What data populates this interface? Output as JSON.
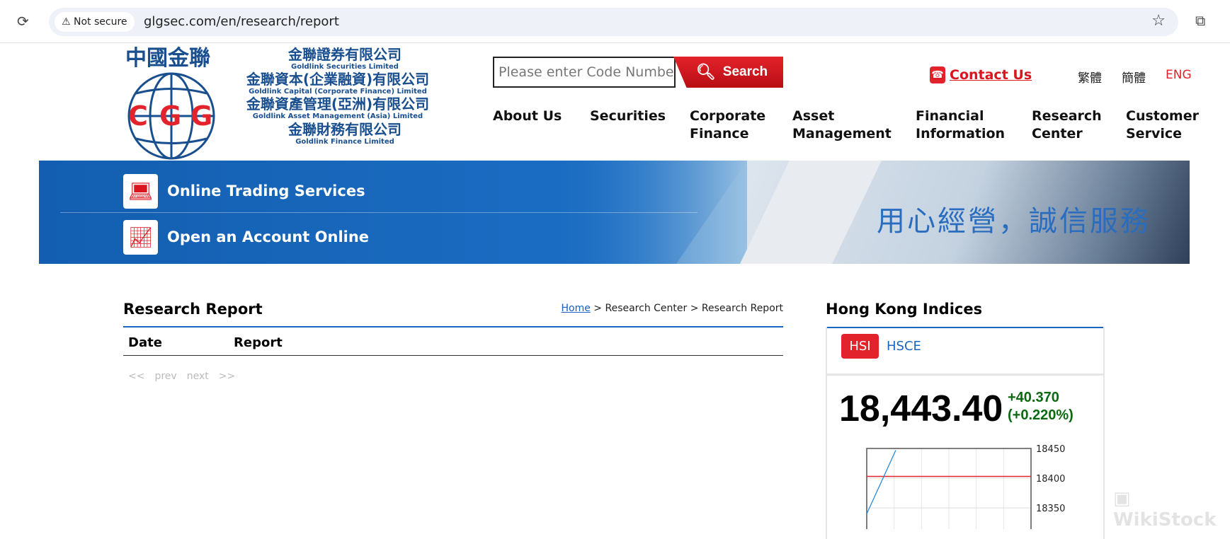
{
  "browser": {
    "security_label": "Not secure",
    "url": "glgsec.com/en/research/report"
  },
  "logo": {
    "cn_brand": "中國金聯",
    "initials": "CGG",
    "lines": [
      {
        "cn": "金聯證券有限公司",
        "en": "Goldlink Securities Limited"
      },
      {
        "cn": "金聯資本(企業融資)有限公司",
        "en": "Goldlink Capital (Corporate Finance) Limited"
      },
      {
        "cn": "金聯資產管理(亞洲)有限公司",
        "en": "Goldlink Asset Management (Asia) Limited"
      },
      {
        "cn": "金聯財務有限公司",
        "en": "Goldlink  Finance  Limited"
      }
    ]
  },
  "search": {
    "placeholder": "Please enter Code Number",
    "button": "Search"
  },
  "contact": "Contact Us",
  "languages": [
    "繁體",
    "簡體",
    "ENG"
  ],
  "nav": [
    [
      "About Us"
    ],
    [
      "Securities"
    ],
    [
      "Corporate",
      "Finance"
    ],
    [
      "Asset",
      "Management"
    ],
    [
      "Financial",
      "Information"
    ],
    [
      "Research",
      "Center"
    ],
    [
      "Customer",
      "Service"
    ]
  ],
  "banner": {
    "online_trading": "Online Trading Services",
    "open_account": "Open an Account Online",
    "slogan": "用心經營，誠信服務"
  },
  "main": {
    "title": "Research Report",
    "breadcrumb": [
      "Home",
      "Research Center",
      "Research Report"
    ],
    "columns": [
      "Date",
      "Report"
    ],
    "pager": [
      "<<",
      "prev",
      "next",
      ">>"
    ]
  },
  "indices": {
    "title": "Hong Kong Indices",
    "tabs": [
      "HSI",
      "HSCE"
    ],
    "active_tab": "HSI",
    "value": "18,443.40",
    "change": "+40.370",
    "change_pct": "(+0.220%)",
    "colors": {
      "up": "#0b6a10",
      "active_tab": "#e3232b",
      "accent": "#1a67c0"
    }
  },
  "chart_data": {
    "type": "line",
    "y_ticks": [
      18450,
      18400,
      18350
    ],
    "reference_line": 18403,
    "series": [
      {
        "points": [
          [
            0,
            18340
          ],
          [
            1,
            18447
          ]
        ]
      }
    ],
    "colors": {
      "line": "#2a8ad8",
      "reference": "#e3232b"
    }
  },
  "watermark": "WikiStock"
}
